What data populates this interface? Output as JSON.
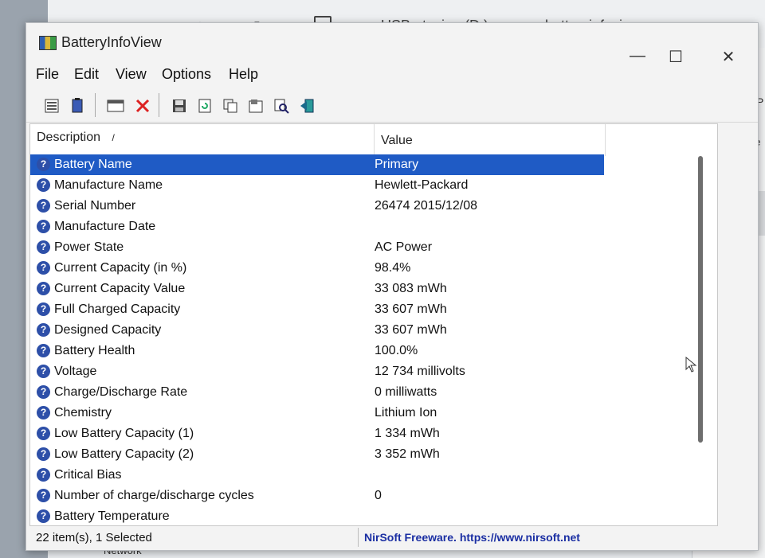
{
  "background_window": {
    "nav_back": "←",
    "nav_forward": "→",
    "nav_up": "↑",
    "nav_refresh": "↻",
    "path_sep": "›",
    "path_drive": "USB-stasjon (D:)",
    "path_folder": "batteryinfoview",
    "right_text_1": "P",
    "right_text_2": "me",
    "bottom_text": "Network"
  },
  "window": {
    "title": "BatteryInfoView",
    "minimize": "—",
    "maximize": "☐",
    "close": "✕"
  },
  "menu": [
    "File",
    "Edit",
    "View",
    "Options",
    "Help"
  ],
  "columns": {
    "description": "Description",
    "value": "Value",
    "sort_indicator": "/"
  },
  "rows": [
    {
      "desc": "Battery Name",
      "value": "Primary"
    },
    {
      "desc": "Manufacture Name",
      "value": "Hewlett-Packard"
    },
    {
      "desc": "Serial Number",
      "value": "26474 2015/12/08"
    },
    {
      "desc": "Manufacture Date",
      "value": ""
    },
    {
      "desc": "Power State",
      "value": "AC Power"
    },
    {
      "desc": "Current Capacity (in %)",
      "value": "98.4%"
    },
    {
      "desc": "Current Capacity Value",
      "value": "33 083 mWh"
    },
    {
      "desc": "Full Charged Capacity",
      "value": "33 607 mWh"
    },
    {
      "desc": "Designed Capacity",
      "value": "33 607 mWh"
    },
    {
      "desc": "Battery Health",
      "value": "100.0%"
    },
    {
      "desc": "Voltage",
      "value": "12 734 millivolts"
    },
    {
      "desc": "Charge/Discharge Rate",
      "value": "0 milliwatts"
    },
    {
      "desc": "Chemistry",
      "value": "Lithium Ion"
    },
    {
      "desc": "Low Battery Capacity (1)",
      "value": "1 334 mWh"
    },
    {
      "desc": "Low Battery Capacity (2)",
      "value": "3 352 mWh"
    },
    {
      "desc": "Critical Bias",
      "value": ""
    },
    {
      "desc": "Number of charge/discharge cycles",
      "value": "0"
    },
    {
      "desc": "Battery Temperature",
      "value": ""
    }
  ],
  "selected_row": 0,
  "status": {
    "items": "22 item(s), 1 Selected",
    "link": "NirSoft Freeware. https://www.nirsoft.net"
  },
  "colors": {
    "selection": "#1f5bc5",
    "link": "#1b2fa3",
    "row_icon": "#2d4fa8"
  }
}
